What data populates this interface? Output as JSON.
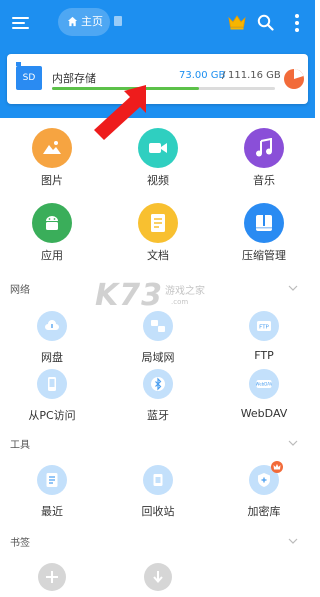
{
  "header": {
    "tab_home": "主页",
    "icons": [
      "menu-icon",
      "home-icon",
      "document-icon",
      "crown-icon",
      "search-icon",
      "more-vertical-icon"
    ],
    "colors": {
      "bar": "#1d8ff0"
    }
  },
  "storage": {
    "badge": "SD",
    "name": "内部存储",
    "used": "73.00 GB",
    "separator": "/",
    "total": "111.16 GB",
    "used_fraction": 0.657,
    "colors": {
      "used": "#1d8ff0",
      "bar": "#5cc149",
      "pie": "#f26b3a"
    }
  },
  "categories": [
    {
      "label": "图片",
      "icon": "image-icon",
      "color": "#f6a441"
    },
    {
      "label": "视频",
      "icon": "video-icon",
      "color": "#2fcfc0"
    },
    {
      "label": "音乐",
      "icon": "music-icon",
      "color": "#8a4fd8"
    },
    {
      "label": "应用",
      "icon": "android-icon",
      "color": "#3aae5a"
    },
    {
      "label": "文档",
      "icon": "document-icon",
      "color": "#f8c030"
    },
    {
      "label": "压缩管理",
      "icon": "archive-icon",
      "color": "#2a8bf2"
    }
  ],
  "network": {
    "title": "网络",
    "items": [
      {
        "label": "网盘",
        "icon": "cloud-icon"
      },
      {
        "label": "局域网",
        "icon": "lan-icon"
      },
      {
        "label": "FTP",
        "icon": "ftp-icon"
      },
      {
        "label": "从PC访问",
        "icon": "pc-access-icon"
      },
      {
        "label": "蓝牙",
        "icon": "bluetooth-icon"
      },
      {
        "label": "WebDAV",
        "icon": "webdav-icon"
      }
    ]
  },
  "tools": {
    "title": "工具",
    "items": [
      {
        "label": "最近",
        "icon": "recent-icon"
      },
      {
        "label": "回收站",
        "icon": "recycle-bin-icon"
      },
      {
        "label": "加密库",
        "icon": "vault-icon"
      }
    ]
  },
  "bookmarks": {
    "title": "书签",
    "items": [
      {
        "icon": "add-icon"
      },
      {
        "icon": "download-icon"
      }
    ]
  },
  "watermark": {
    "main": "K73",
    "sub": "游戏之家",
    "url": ".com"
  }
}
